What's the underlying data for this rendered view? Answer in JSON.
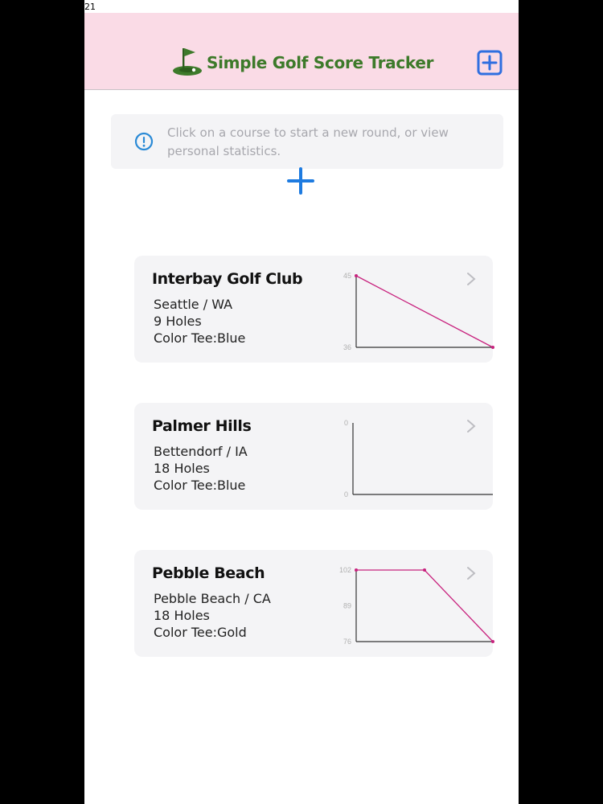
{
  "status": {
    "time": "21"
  },
  "header": {
    "title": "Simple Golf Score Tracker",
    "icons": {
      "logo": "golf-flag-icon",
      "add": "plus-square-icon"
    },
    "colors": {
      "background": "#fadbe6",
      "title": "#3d7a2a",
      "accent": "#2f6fe0"
    }
  },
  "info": {
    "text": "Click on a course to start a new round, or view personal statistics.",
    "icon": "info-circle-icon"
  },
  "new_round": {
    "icon": "plus-icon"
  },
  "courses": [
    {
      "name": "Interbay Golf Club",
      "location": "Seattle / WA",
      "holes": "9 Holes",
      "tee": "Color Tee:Blue",
      "chart_data": {
        "type": "line",
        "x": [
          1,
          2
        ],
        "values": [
          45,
          36
        ],
        "ylim": [
          36,
          45
        ],
        "ytick_labels": [
          "45",
          "36"
        ]
      }
    },
    {
      "name": "Palmer Hills",
      "location": "Bettendorf / IA",
      "holes": "18 Holes",
      "tee": "Color Tee:Blue",
      "chart_data": {
        "type": "line",
        "x": [],
        "values": [],
        "ylim": [
          0,
          0
        ],
        "ytick_labels": [
          "0",
          "0"
        ]
      }
    },
    {
      "name": "Pebble Beach",
      "location": "Pebble Beach / CA",
      "holes": "18 Holes",
      "tee": "Color Tee:Gold",
      "chart_data": {
        "type": "line",
        "x": [
          1,
          2,
          3
        ],
        "values": [
          102,
          102,
          76
        ],
        "ylim": [
          76,
          102
        ],
        "ytick_labels": [
          "102",
          "89",
          "76"
        ]
      }
    }
  ],
  "chart_colors": {
    "line": "#c8227e",
    "axis": "#333333",
    "tick": "#b0b0b0"
  }
}
